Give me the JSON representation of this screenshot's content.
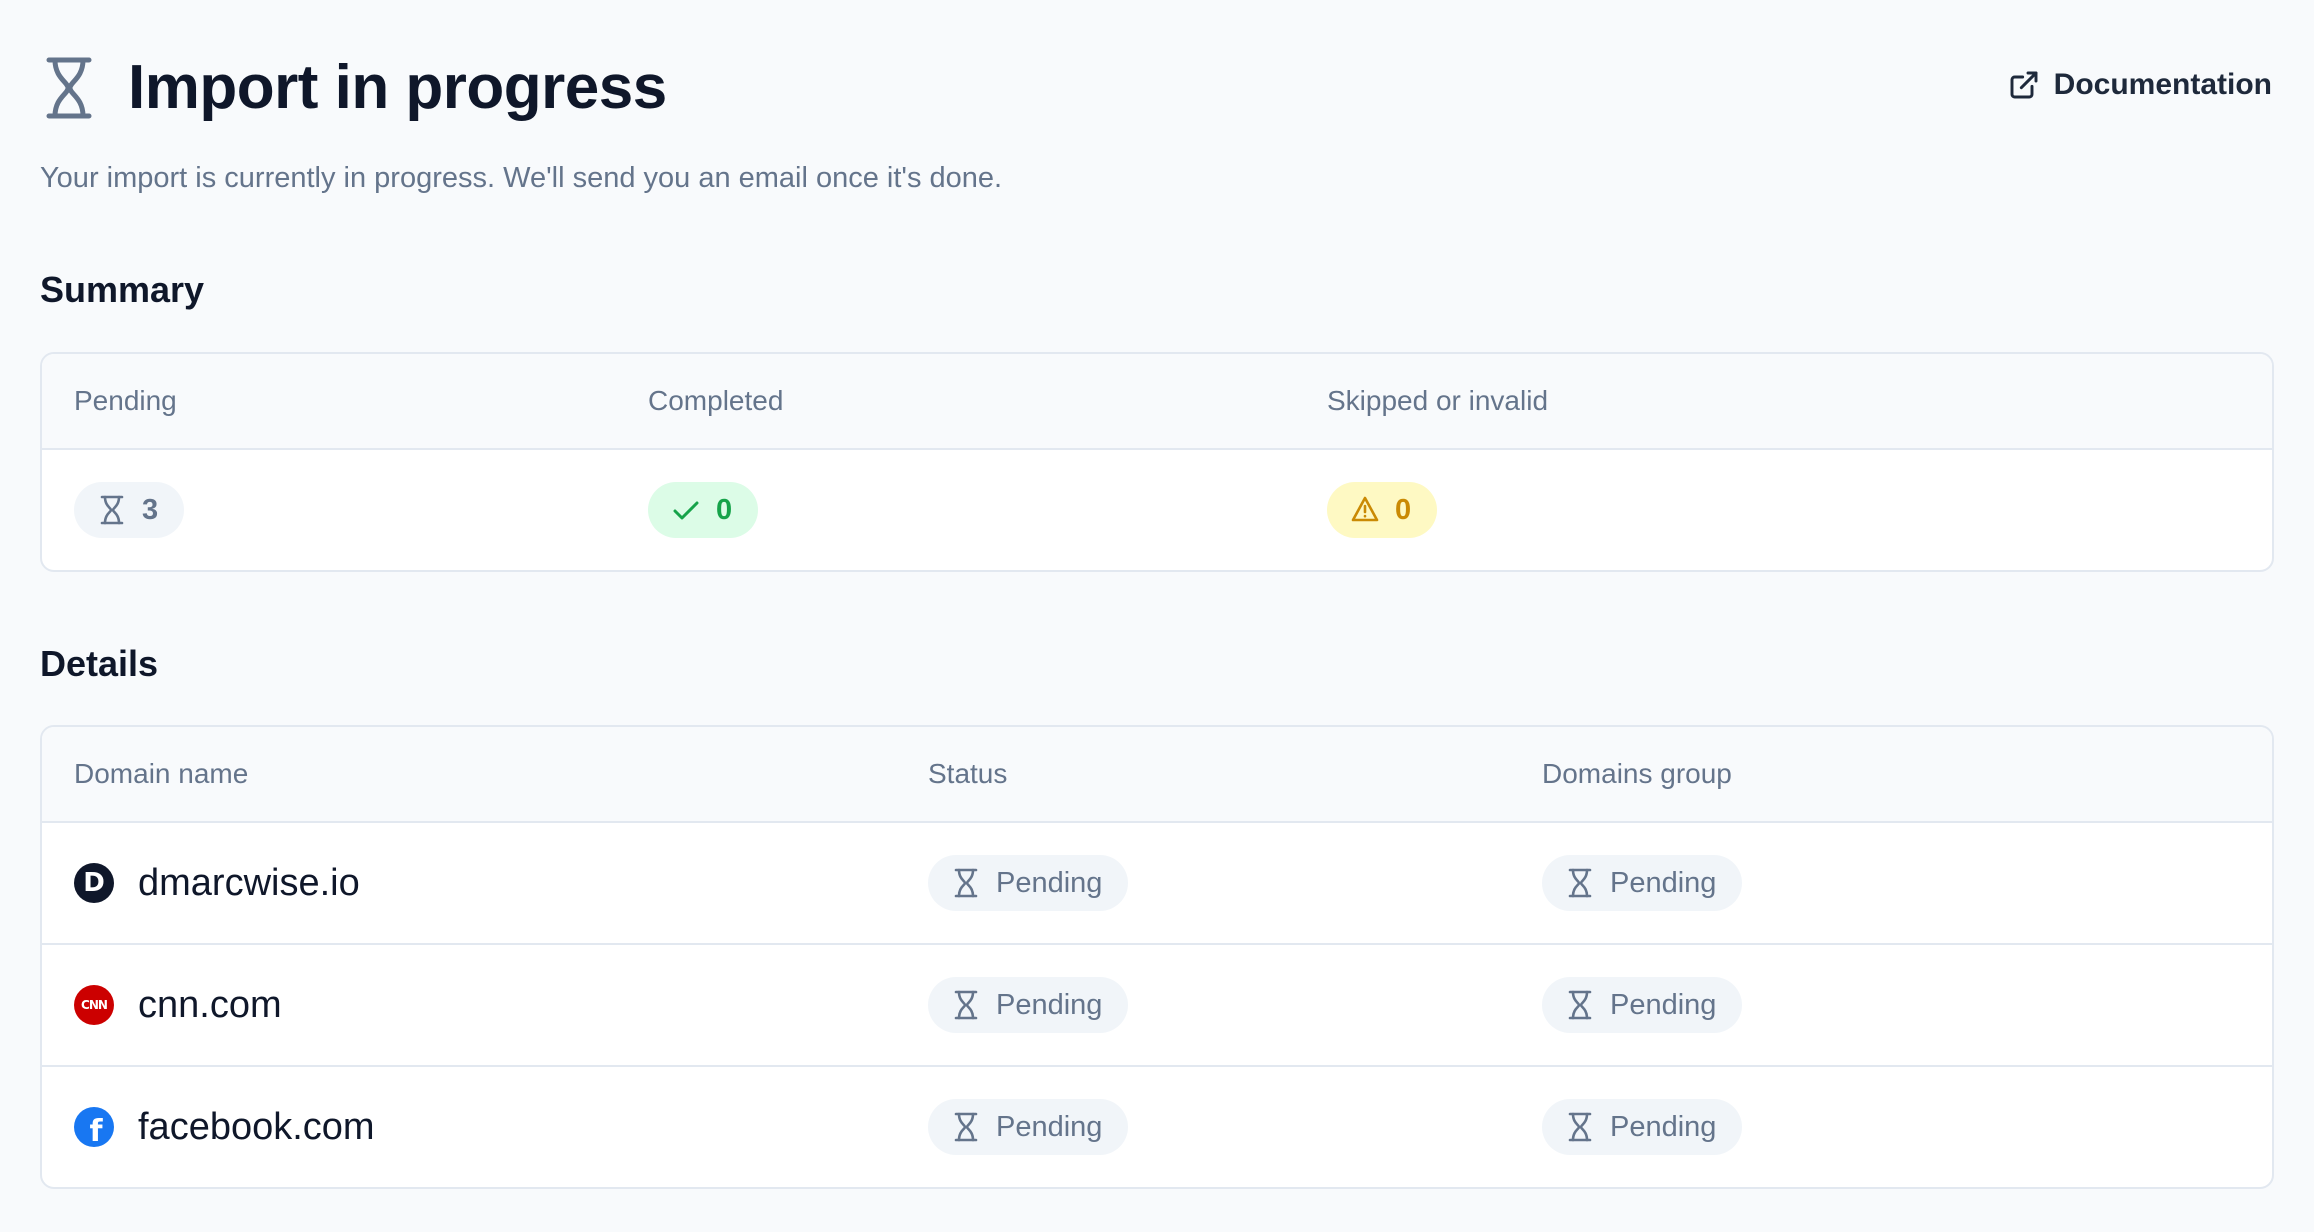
{
  "header": {
    "title": "Import in progress",
    "subtitle": "Your import is currently in progress. We'll send you an email once it's done.",
    "documentation_label": "Documentation",
    "title_icon": "hourglass-icon",
    "documentation_icon": "external-link-icon"
  },
  "summary": {
    "title": "Summary",
    "columns": [
      "Pending",
      "Completed",
      "Skipped or invalid"
    ],
    "pending_count": "3",
    "completed_count": "0",
    "skipped_count": "0"
  },
  "details": {
    "title": "Details",
    "columns": [
      "Domain name",
      "Status",
      "Domains group"
    ],
    "rows": [
      {
        "domain": "dmarcwise.io",
        "status": "Pending",
        "group": "Pending",
        "favicon_text": "D"
      },
      {
        "domain": "cnn.com",
        "status": "Pending",
        "group": "Pending",
        "favicon_text": "CNN"
      },
      {
        "domain": "facebook.com",
        "status": "Pending",
        "group": "Pending",
        "favicon_text": "f"
      }
    ]
  },
  "colors": {
    "background": "#f8fafc",
    "success": "#16a34a",
    "warning": "#ca8a04",
    "muted": "#64748b",
    "cnn_red": "#cc0000",
    "facebook_blue": "#1877f2"
  }
}
